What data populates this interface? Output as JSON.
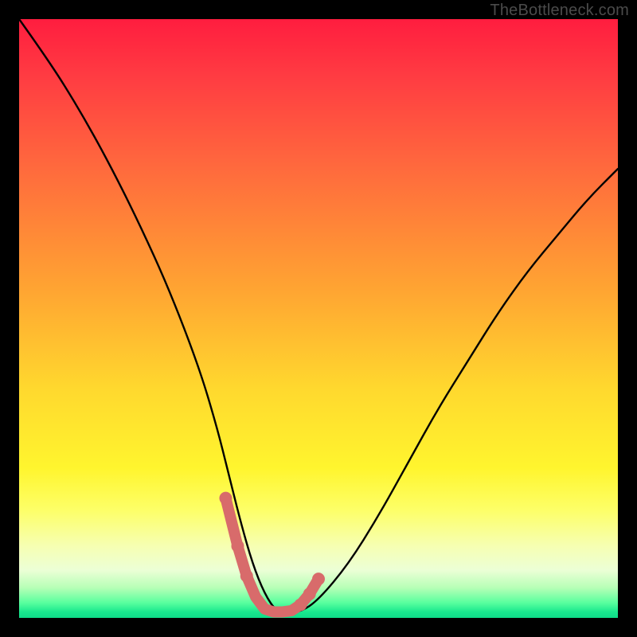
{
  "watermark": "TheBottleneck.com",
  "chart_data": {
    "type": "line",
    "title": "",
    "xlabel": "",
    "ylabel": "",
    "xlim": [
      0,
      100
    ],
    "ylim": [
      0,
      100
    ],
    "series": [
      {
        "name": "bottleneck-curve",
        "x": [
          0,
          5,
          10,
          15,
          20,
          25,
          30,
          33,
          35,
          37,
          39,
          41,
          43,
          45,
          47,
          50,
          55,
          60,
          65,
          70,
          75,
          80,
          85,
          90,
          95,
          100
        ],
        "y": [
          100,
          93,
          85,
          76,
          66,
          55,
          42,
          32,
          24,
          16,
          9,
          4,
          1,
          1,
          1,
          3,
          9,
          17,
          26,
          35,
          43,
          51,
          58,
          64,
          70,
          75
        ]
      }
    ],
    "markers": {
      "name": "highlight-region",
      "x": [
        34.5,
        36.5,
        38.0,
        39.5,
        41.0,
        42.5,
        44.0,
        45.5,
        47.0,
        48.5,
        50.0
      ],
      "y": [
        20.0,
        12.0,
        7.0,
        3.5,
        1.5,
        1.0,
        1.0,
        1.2,
        2.2,
        4.0,
        6.5
      ],
      "color": "#d86b6b"
    },
    "colors": {
      "curve": "#000000",
      "marker": "#d86b6b",
      "gradient_top": "#ff1d3f",
      "gradient_bottom": "#0fdc88"
    }
  }
}
